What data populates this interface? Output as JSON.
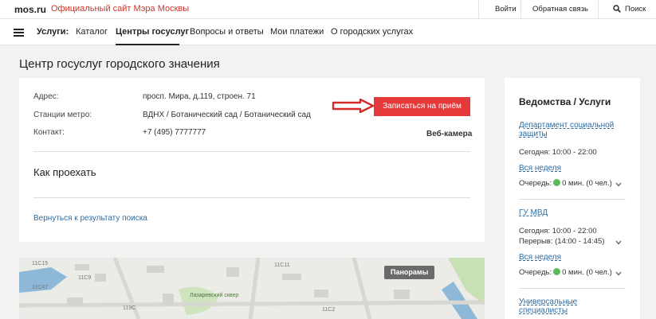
{
  "header": {
    "logo": "mos.ru",
    "site_title": "Официальный сайт Мэра Москвы",
    "login": "Войти",
    "feedback": "Обратная связь",
    "search": "Поиск"
  },
  "nav": {
    "services_label": "Услуги:",
    "items": [
      "Каталог",
      "Центры госуслуг",
      "Вопросы и ответы",
      "Мои платежи",
      "О городских услугах"
    ],
    "active_index": 1
  },
  "page": {
    "title": "Центр госуслуг городского значения"
  },
  "card": {
    "address_label": "Адрес:",
    "address_value": "просп. Мира, д.119, строен. 71",
    "metro_label": "Станции метро:",
    "metro_value": "ВДНХ / Ботанический сад / Ботанический сад",
    "contact_label": "Контакт:",
    "contact_value": "+7 (495) 7777777",
    "appointment_button": "Записаться на приём",
    "webcam": "Веб-камера",
    "how_to_get": "Как проехать",
    "back_link": "Вернуться к результату поиска"
  },
  "map": {
    "panorama": "Панорамы",
    "labels": [
      "11С15",
      "11С9",
      "11С47",
      "11С11",
      "Лазаревский сквер",
      "119С",
      "11С2"
    ]
  },
  "sidebar": {
    "heading": "Ведомства / Услуги",
    "departments": [
      {
        "name": "Департамент социальной защиты",
        "today": "Сегодня: 10:00 - 22:00",
        "week_link": "Вся неделя",
        "queue_prefix": "Очередь:",
        "queue_value": "0 мин. (0 чел.)"
      },
      {
        "name": "ГУ МВД",
        "today": "Сегодня: 10:00 - 22:00",
        "break": "Перерыв: (14:00 - 14:45)",
        "week_link": "Вся неделя",
        "queue_prefix": "Очередь:",
        "queue_value": "0 мин. (0 чел.)"
      },
      {
        "name": "Универсальные специалисты"
      }
    ]
  },
  "colors": {
    "accent_red": "#e6393a",
    "link_blue": "#2d6ca2",
    "queue_green": "#5cb85c"
  }
}
